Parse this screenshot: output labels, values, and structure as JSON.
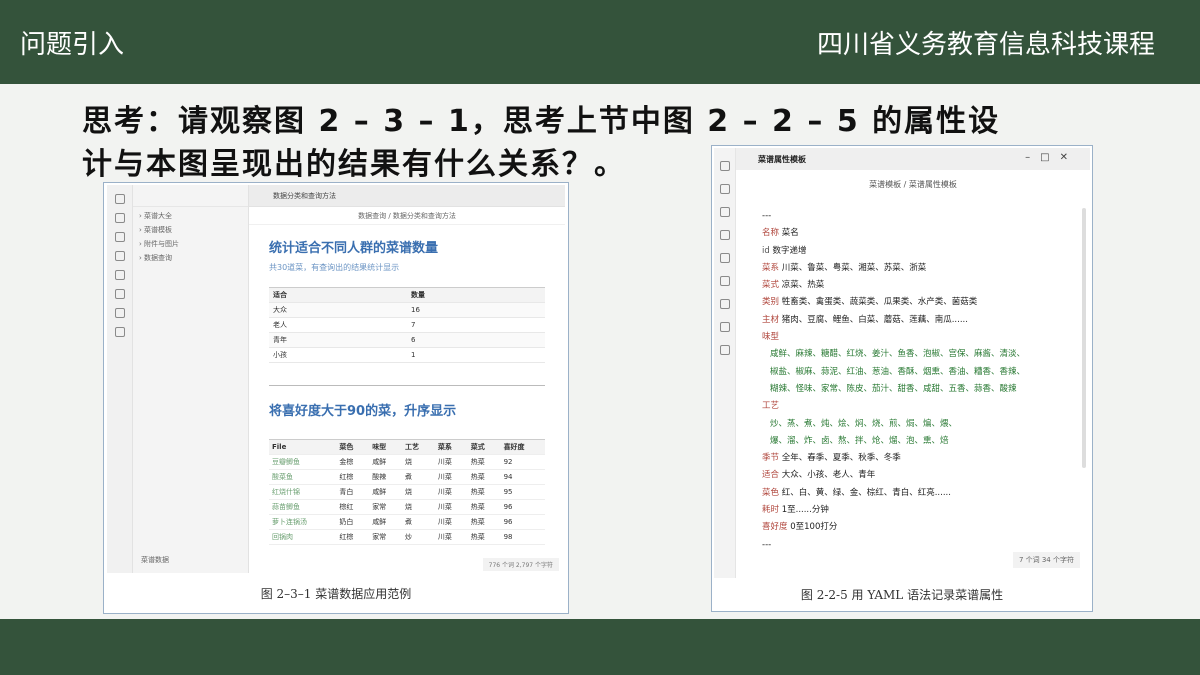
{
  "header": {
    "left": "问题引入",
    "right": "四川省义务教育信息科技课程"
  },
  "question": {
    "line1": "思考：请观察图 2 – 3 – 1，思考上节中图 2 – 2 – 5 的属性设",
    "line2": "计与本图呈现出的结果有什么关系？。"
  },
  "fig1": {
    "tab": "数据分类和查询方法",
    "crumb": "数据查询 / 数据分类和查询方法",
    "sidebar": [
      "菜谱大全",
      "菜谱模板",
      "附件与图片",
      "数据查询"
    ],
    "sidebar_footer": "菜谱数据",
    "heading1": "统计适合不同人群的菜谱数量",
    "sub1": "共30道菜，有查询出的结果统计显示",
    "table1": {
      "headers": [
        "适合",
        "数量"
      ],
      "rows": [
        [
          "大众",
          "16"
        ],
        [
          "老人",
          "7"
        ],
        [
          "青年",
          "6"
        ],
        [
          "小孩",
          "1"
        ]
      ]
    },
    "heading2": "将喜好度大于90的菜，升序显示",
    "table2": {
      "headers": [
        "File",
        "菜色",
        "味型",
        "工艺",
        "菜系",
        "菜式",
        "喜好度"
      ],
      "rows": [
        [
          "豆瓣鲫鱼",
          "金棕",
          "咸鲜",
          "烧",
          "川菜",
          "热菜",
          "92"
        ],
        [
          "酸菜鱼",
          "红棕",
          "酸辣",
          "煮",
          "川菜",
          "热菜",
          "94"
        ],
        [
          "红烧什锦",
          "青白",
          "咸鲜",
          "烧",
          "川菜",
          "热菜",
          "95"
        ],
        [
          "蒜苗鲫鱼",
          "棕红",
          "家常",
          "烧",
          "川菜",
          "热菜",
          "96"
        ],
        [
          "萝卜连锅汤",
          "奶白",
          "咸鲜",
          "煮",
          "川菜",
          "热菜",
          "96"
        ],
        [
          "回锅肉",
          "红棕",
          "家常",
          "炒",
          "川菜",
          "热菜",
          "98"
        ]
      ]
    },
    "status": "776 个词  2,797 个字符",
    "caption": "图 2–3–1  菜谱数据应用范例"
  },
  "fig2": {
    "tab": "菜谱属性模板",
    "crumb": "菜谱模板 / 菜谱属性模板",
    "lines": [
      {
        "k": "",
        "v": "---"
      },
      {
        "k": "名称",
        "v": "菜名"
      },
      {
        "k": "id",
        "v": "数字递增"
      },
      {
        "k": "菜系",
        "v": "川菜、鲁菜、粤菜、湘菜、苏菜、浙菜"
      },
      {
        "k": "菜式",
        "v": "凉菜、热菜"
      },
      {
        "k": "类别",
        "v": "牲畜类、禽蛋类、蔬菜类、瓜果类、水产类、菌菇类"
      },
      {
        "k": "主材",
        "v": "猪肉、豆腐、鲤鱼、白菜、蘑菇、莲藕、南瓜......"
      },
      {
        "k": "味型",
        "v": ""
      },
      {
        "k": "",
        "v": "咸鲜、麻辣、糖醋、红烧、姜汁、鱼香、泡椒、宫保、麻酱、清淡、"
      },
      {
        "k": "",
        "v": "椒盐、椒麻、蒜泥、红油、葱油、香酥、烟熏、香油、糟香、香辣、"
      },
      {
        "k": "",
        "v": "糊辣、怪味、家常、陈皮、茄汁、甜香、咸甜、五香、蒜香、酸辣"
      },
      {
        "k": "工艺",
        "v": ""
      },
      {
        "k": "",
        "v": "炒、蒸、煮、炖、烩、焖、烧、煎、焗、煸、煨、"
      },
      {
        "k": "",
        "v": "爆、溜、炸、卤、熬、拌、炝、熘、泡、熏、焙"
      },
      {
        "k": "季节",
        "v": "全年、春季、夏季、秋季、冬季"
      },
      {
        "k": "适合",
        "v": "大众、小孩、老人、青年"
      },
      {
        "k": "菜色",
        "v": "红、白、黄、绿、金、棕红、青白、红亮......"
      },
      {
        "k": "耗时",
        "v": "1至......分钟"
      },
      {
        "k": "喜好度",
        "v": "0至100打分"
      },
      {
        "k": "",
        "v": "---"
      }
    ],
    "status": "7 个词  34 个字符",
    "caption": "图 2-2-5  用 YAML 语法记录菜谱属性"
  }
}
